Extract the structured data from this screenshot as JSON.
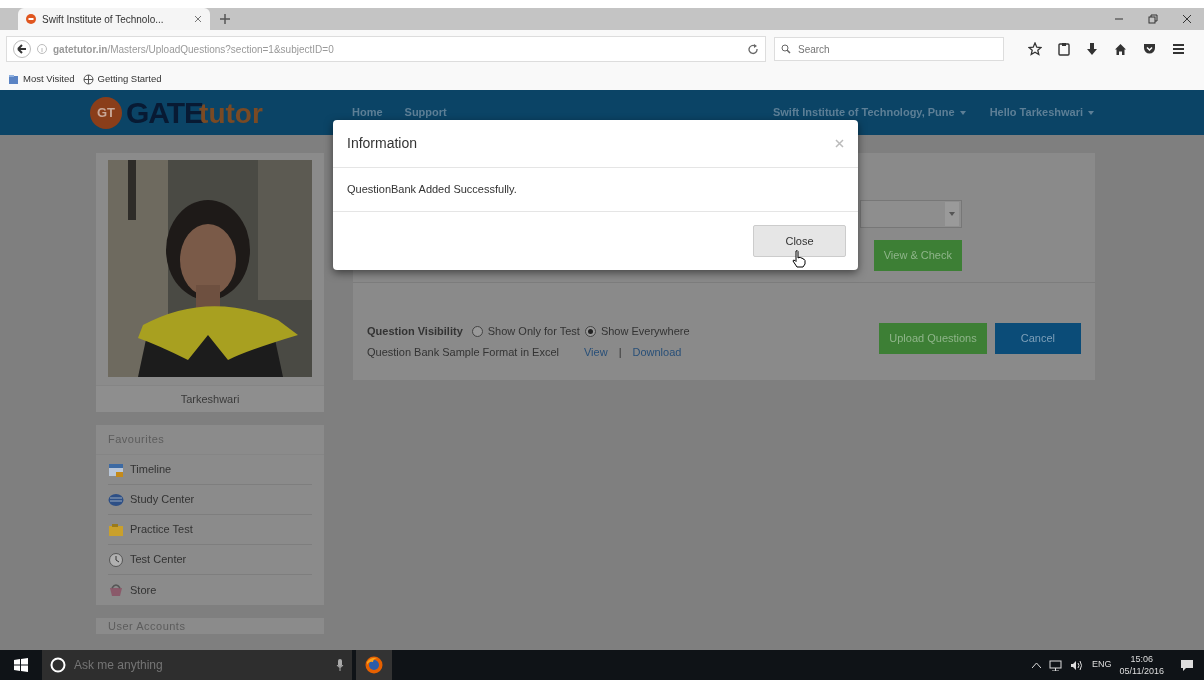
{
  "browser": {
    "tab_title": "Swift Institute of Technolo...",
    "address": "**gatetutor.in**/Masters/UploadQuestions?section=1&subjectID=0",
    "search": {
      "placeholder": "Search"
    },
    "bookmarks": [
      "Most Visited",
      "Getting Started"
    ]
  },
  "site_nav": {
    "logo_badge": "GT",
    "logo": [
      "GATE",
      "tutor"
    ],
    "links": [
      "Home",
      "Support"
    ],
    "institute": "Swift Institute of Technology, Pune",
    "user": "Hello Tarkeshwari"
  },
  "profile": {
    "name": "Tarkeshwari"
  },
  "favourites": {
    "title": "Favourites",
    "items": [
      "Timeline",
      "Study Center",
      "Practice Test",
      "Test Center",
      "Store"
    ]
  },
  "user_accounts": {
    "title": "User Accounts"
  },
  "upload": {
    "view_check": "View & Check",
    "visibility": {
      "label": "Question Visibility",
      "options": [
        {
          "label": "Show Only for Test",
          "selected": false
        },
        {
          "label": "Show Everywhere",
          "selected": true
        }
      ]
    },
    "sample": {
      "label": "Question Bank Sample Format in Excel",
      "links": [
        "View",
        "Download"
      ],
      "separator": "|"
    },
    "buttons": [
      {
        "label": "Upload Questions",
        "kind": "success"
      },
      {
        "label": "Cancel",
        "kind": "primary"
      }
    ]
  },
  "modal": {
    "title": "Information",
    "message": "QuestionBank Added Successfully.",
    "button": "Close"
  },
  "taskbar": {
    "search_placeholder": "Ask me anything",
    "language": "ENG",
    "time": "15:06",
    "date": "05/11/2016"
  }
}
